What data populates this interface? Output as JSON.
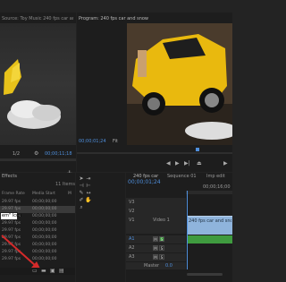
{
  "source_monitor": {
    "title": "Source: Toy Music 240 fps car and snow",
    "zoom": "1/2",
    "timecode": "00;00;11;18"
  },
  "program_monitor": {
    "title": "Program: 240 fps car and snow",
    "timecode": "00;00;01;24",
    "zoom": "Fit"
  },
  "project_panel": {
    "title": "Effects",
    "item_count": "11 Items",
    "columns": [
      "Frame Rate",
      "Media Start",
      "M"
    ],
    "rows": [
      {
        "rate": "29.97 fps",
        "start": "00;00;00;00"
      },
      {
        "rate": "29.97 fps",
        "start": "00;00;00;00"
      },
      {
        "rate": "29.97 fps",
        "start": "00;00;00;00"
      },
      {
        "rate": "29.97 fps",
        "start": "00;00;00;00"
      },
      {
        "rate": "29.97 fps",
        "start": "00;00;00;00"
      },
      {
        "rate": "29.97 fps",
        "start": "00;00;00;00"
      },
      {
        "rate": "29.97 fps",
        "start": "00;00;00;00"
      },
      {
        "rate": "29.97 fps",
        "start": "00;00;00;00"
      },
      {
        "rate": "29.97 fps",
        "start": "00;00;00;00"
      }
    ],
    "annotation": "em\" Icon"
  },
  "timeline": {
    "tabs": [
      "240 fps car",
      "Sequence 01",
      "Imp edit"
    ],
    "timecode": "00;00;01;24",
    "ruler_time": "00;00;16;00",
    "tracks": [
      "V3",
      "V2",
      "V1",
      "A1",
      "A2",
      "A3"
    ],
    "video1_label": "Video 1",
    "clip_label": "240 fps car and snow",
    "master_label": "Master",
    "master_value": "0.0",
    "track_buttons": [
      "M",
      "S"
    ]
  },
  "colors": {
    "accent_blue": "#4f8fdc",
    "clip_blue": "#8fb4dc",
    "audio_green": "#3f9b3f",
    "annotation_red": "#d42a2a"
  }
}
